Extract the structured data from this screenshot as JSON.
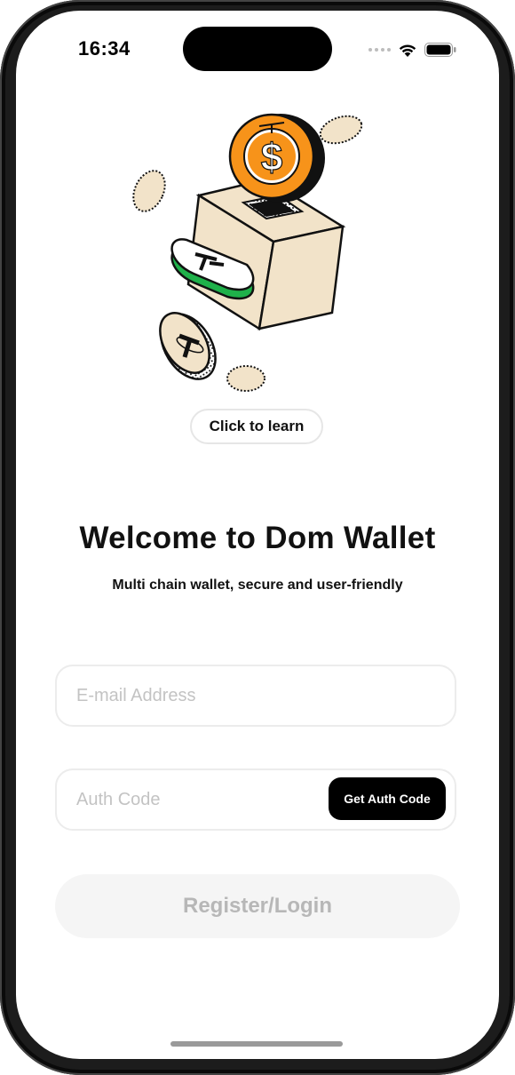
{
  "status_bar": {
    "time": "16:34",
    "icons": [
      "signal-dots-icon",
      "wifi-icon",
      "battery-icon"
    ]
  },
  "illustration": {
    "description_icon": "wallet-box-coins-illustration",
    "colors": {
      "orange": "#F7931A",
      "green": "#1FB14A",
      "beige": "#F2E3C9",
      "outline": "#111111"
    }
  },
  "learn_button": {
    "label": "Click to learn"
  },
  "welcome": {
    "title": "Welcome to Dom Wallet",
    "subtitle": "Multi chain wallet, secure and user-friendly"
  },
  "email": {
    "value": "",
    "placeholder": "E-mail Address"
  },
  "auth_code": {
    "value": "",
    "placeholder": "Auth Code",
    "button_label": "Get Auth Code"
  },
  "register_button": {
    "label": "Register/Login"
  }
}
